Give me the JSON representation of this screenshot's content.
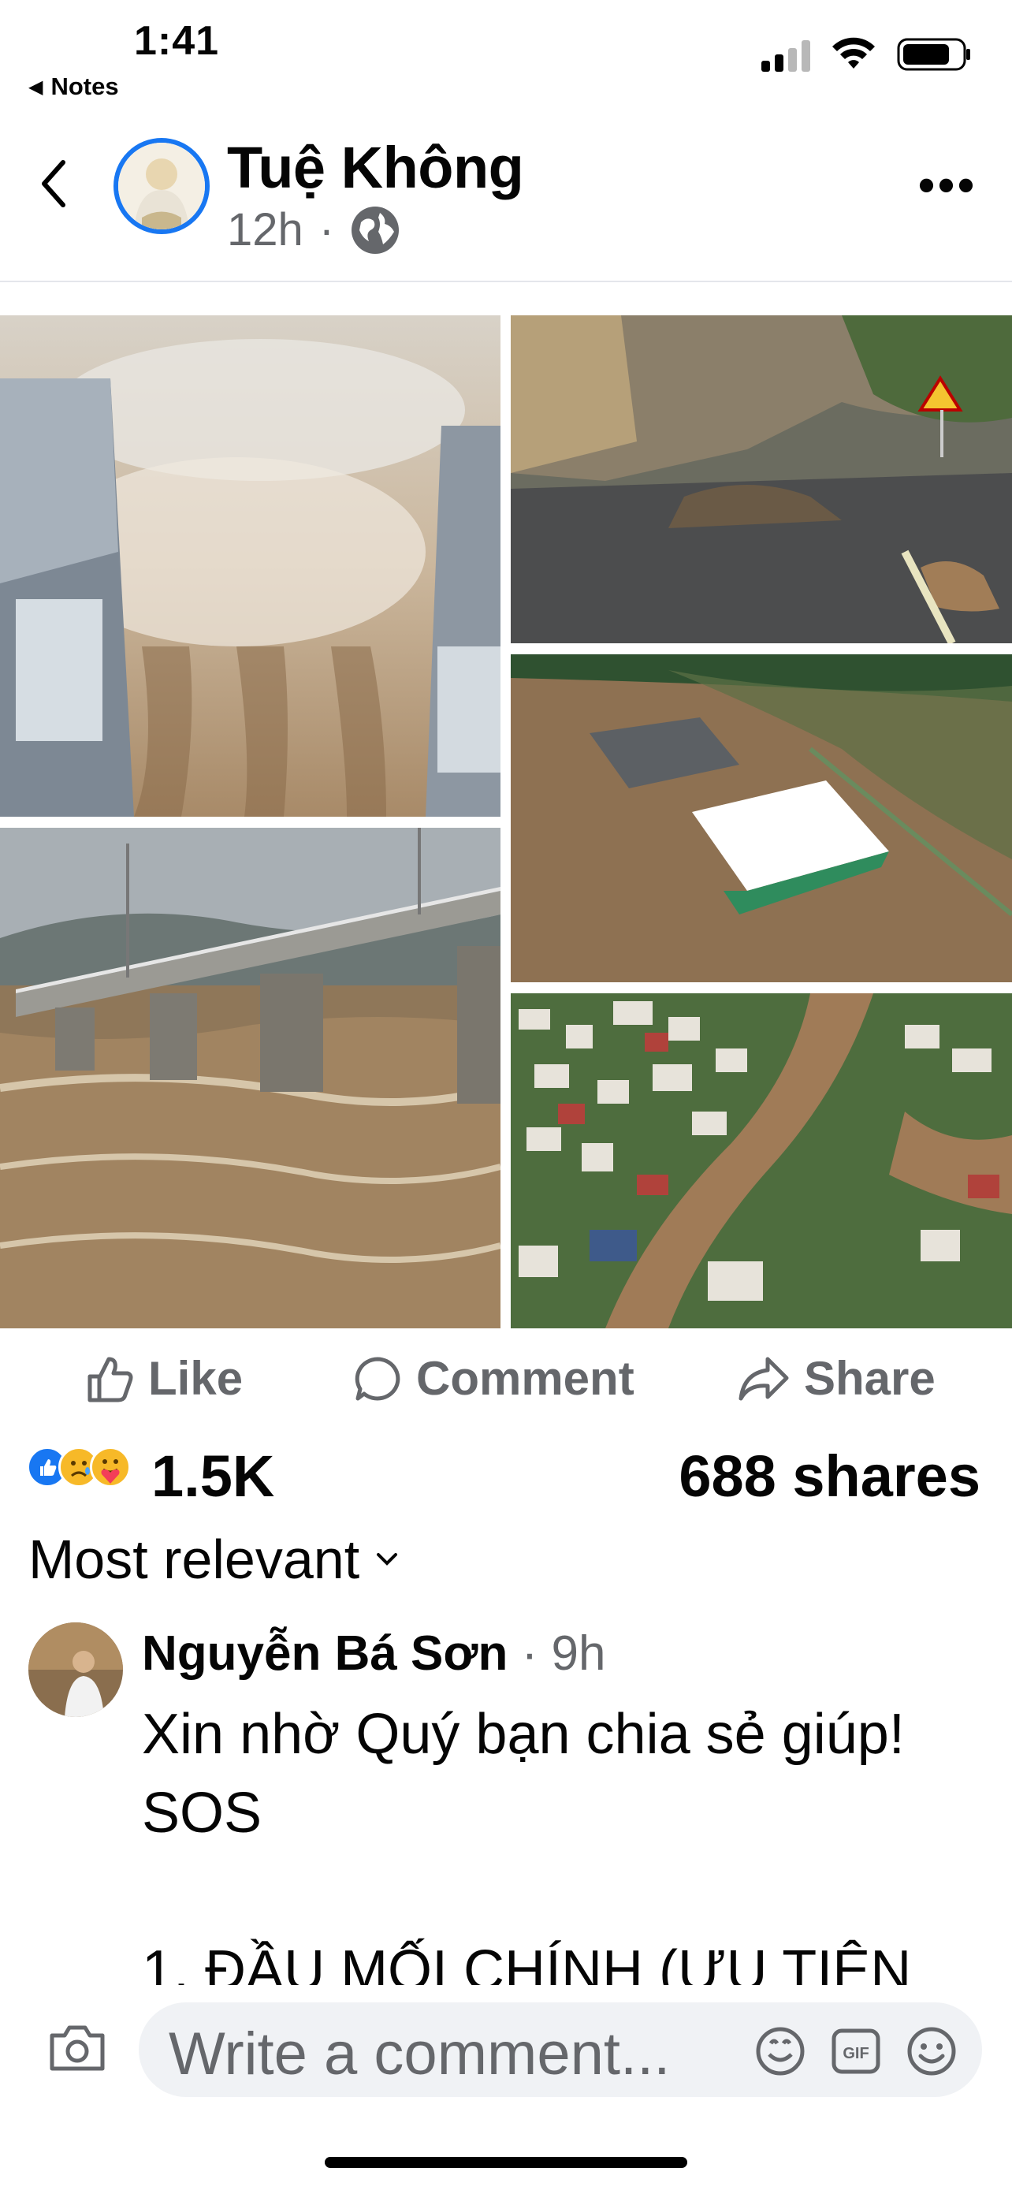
{
  "status_bar": {
    "time": "1:41",
    "back_app": "Notes"
  },
  "post": {
    "author": "Tuệ Không",
    "age": "12h",
    "privacy_icon": "globe-icon",
    "photos": [
      "dam-spillway-photo",
      "landslide-road-photo",
      "flooded-bridge-photo",
      "flooded-farm-photo",
      "flooded-town-aerial-photo"
    ]
  },
  "actions": {
    "like": "Like",
    "comment": "Comment",
    "share": "Share"
  },
  "stats": {
    "reactions": "1.5K",
    "shares": "688 shares"
  },
  "sort": {
    "label": "Most relevant"
  },
  "comment": {
    "author": "Nguyễn Bá Sơn",
    "time": "· 9h",
    "text": "Xin nhờ Quý bạn chia sẻ giúp!\nSOS\n\n1. ĐẦU MỐI CHÍNH (ƯU TIÊN"
  },
  "composer": {
    "placeholder": "Write a comment..."
  },
  "colors": {
    "accent": "#1877f2",
    "muted": "#65676b",
    "input_bg": "#f0f2f5"
  }
}
